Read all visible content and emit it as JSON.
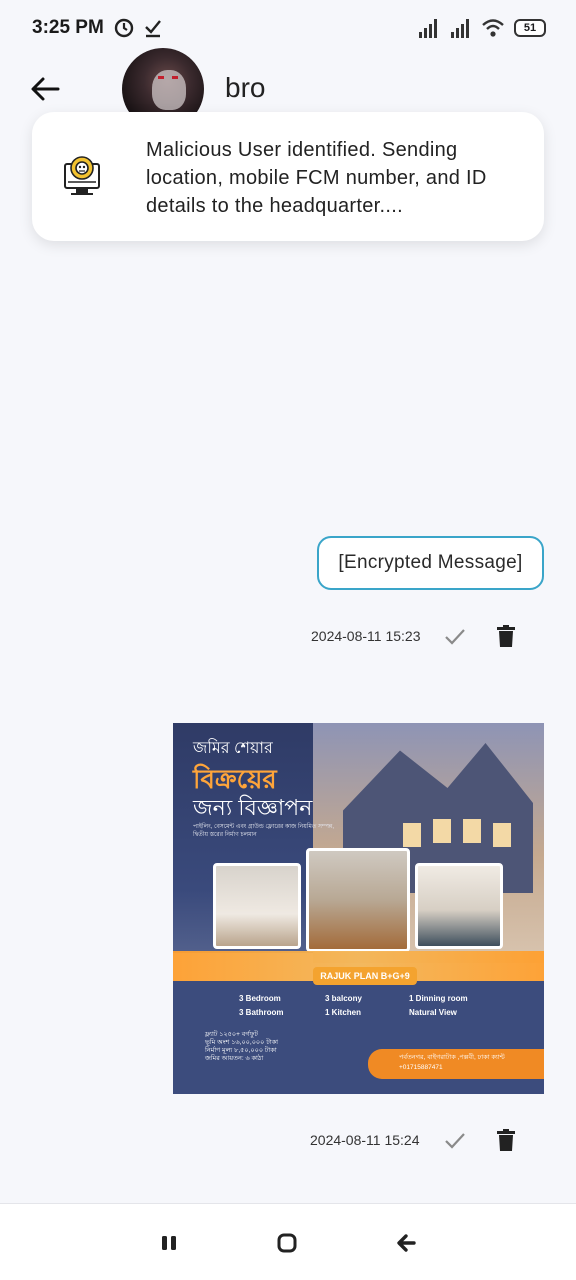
{
  "status_bar": {
    "time": "3:25 PM",
    "battery": "51",
    "icons": [
      "alarm-icon",
      "download-done-icon",
      "signal-icon",
      "signal-icon",
      "wifi-icon",
      "battery-icon"
    ]
  },
  "header": {
    "contact_name": "bro",
    "back_icon": "arrow-left-icon"
  },
  "alert_banner": {
    "icon": "malware-monitor-icon",
    "text": "Malicious User identified. Sending location, mobile FCM number, and ID details to the headquarter...."
  },
  "messages": [
    {
      "type": "text",
      "content": "[Encrypted Message]",
      "timestamp": "2024-08-11 15:23",
      "status_icon": "check-icon",
      "delete_icon": "trash-icon"
    },
    {
      "type": "image",
      "timestamp": "2024-08-11 15:24",
      "status_icon": "check-icon",
      "delete_icon": "trash-icon",
      "image": {
        "title_line1": "জমির শেয়ার",
        "title_line2": "বিক্রয়ের",
        "title_line3": "জন্য বিজ্ঞাপন",
        "subtitle": "পাইলিং, বেসমেন্ট এবং গ্রাউন্ড ফ্লোরের কাজ নিয়মিত সম্পন্ন, দ্বিতীয় স্তরের নির্মাণ চলমান",
        "plan": "RAJUK PLAN B+G+9",
        "features": [
          "3 Bedroom",
          "3 balcony",
          "1 Dinning room",
          "3 Bathroom",
          "1 Kitchen",
          "Natural View"
        ],
        "bullets": [
          "ফ্ল্যাট ১২৫০+ বর্গফুট",
          "ভূমি অংশ ১৬,০০,০০০ টাকা",
          "নির্মাণ মূল্য ৮,৫০,০০০ টাকা",
          "জমির আয়তন: ৬ কাঠা"
        ],
        "address": "পর্বতনগর, বাইগরাটাক ,পল্লবী, ঢাকা ক্যান্ট",
        "phone": "+01715887471"
      }
    }
  ],
  "nav_bar": {
    "buttons": [
      "recents-icon",
      "home-icon",
      "back-icon"
    ]
  }
}
